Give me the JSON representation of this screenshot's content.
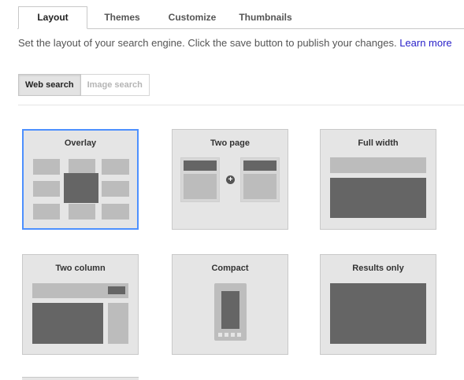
{
  "tabs": [
    {
      "label": "Layout",
      "active": true
    },
    {
      "label": "Themes",
      "active": false
    },
    {
      "label": "Customize",
      "active": false
    },
    {
      "label": "Thumbnails",
      "active": false
    }
  ],
  "description": {
    "text": "Set the layout of your search engine. Click the save button to publish your changes. ",
    "link": "Learn more"
  },
  "search_type": {
    "options": [
      "Web search",
      "Image search"
    ],
    "selected": "Web search"
  },
  "layouts": [
    {
      "title": "Overlay",
      "selected": true
    },
    {
      "title": "Two page",
      "selected": false
    },
    {
      "title": "Full width",
      "selected": false
    },
    {
      "title": "Two column",
      "selected": false
    },
    {
      "title": "Compact",
      "selected": false
    },
    {
      "title": "Results only",
      "selected": false
    }
  ],
  "colors": {
    "selected_border": "#4d90fe",
    "link": "#2a22c9",
    "card_background": "#e5e5e5"
  }
}
